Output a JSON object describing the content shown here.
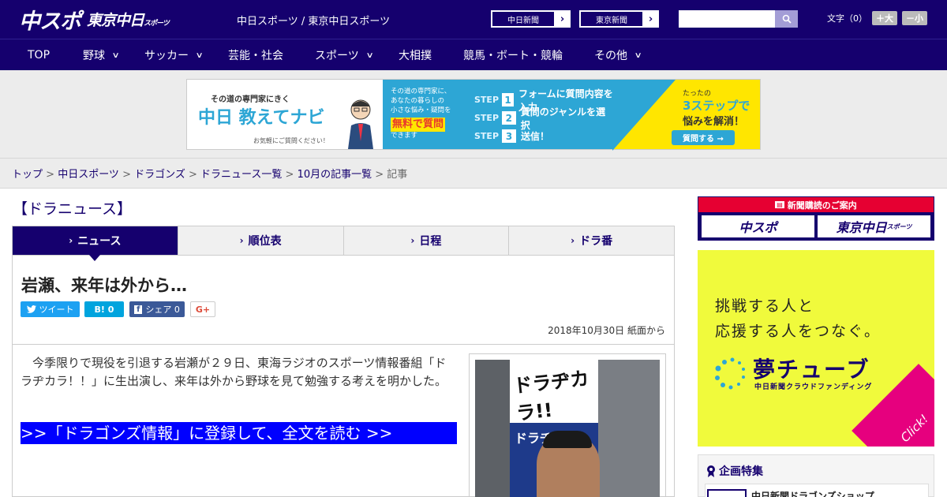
{
  "header": {
    "logo_main": "中スポ",
    "logo_sub": "東京中日",
    "logo_sub_small": "スポーツ",
    "site_title": "中日スポーツ / 東京中日スポーツ",
    "link1": "中日新聞",
    "link2": "東京新聞",
    "search_placeholder": "",
    "font_label": "文字（0）",
    "font_up": "＋大",
    "font_down": "－小"
  },
  "nav": {
    "items": [
      "TOP",
      "野球",
      "サッカー",
      "芸能・社会",
      "スポーツ",
      "大相撲",
      "競馬・ボート・競輪",
      "その他"
    ]
  },
  "banner": {
    "tag": "その道の専門家にきく",
    "brand": "中日 教えてナビ",
    "note": "お気軽にご質問ください！",
    "desc1": "その道の専門家に、",
    "desc2": "あなたの暮らしの",
    "desc3": "小さな悩み・疑問を",
    "desc_hl": "無料で質問",
    "desc4": "できます",
    "step_label": "STEP",
    "steps": [
      "フォームに質問内容を入力",
      "質問のジャンルを選択",
      "送信！"
    ],
    "cta1": "たったの",
    "cta2": "3ステップで",
    "cta3": "悩みを解消！",
    "cta_btn": "質問する →"
  },
  "breadcrumb": {
    "items": [
      "トップ",
      "中日スポーツ",
      "ドラゴンズ",
      "ドラニュース一覧",
      "10月の記事一覧"
    ],
    "current": "記事"
  },
  "section_title": "【ドラニュース】",
  "tabs": [
    "ニュース",
    "順位表",
    "日程",
    "ドラ番"
  ],
  "article": {
    "headline": "岩瀬、来年は外から…",
    "share_tweet": "ツイート",
    "share_hatena": "B! 0",
    "share_fb": "シェア 0",
    "share_gplus": "G+",
    "date": "2018年10月30日 紙面から",
    "body": "　今季限りで現役を引退する岩瀬が２９日、東海ラジオのスポーツ情報番組「ドラヂカラ！！」に生出演し、来年は外から野球を見て勉強する考えを明かした。",
    "read_more": ">>「ドラゴンズ情報」に登録して、全文を読む >>",
    "photo_board_text": "ドラヂカラ!!",
    "photo_board_text2": "ドラヂカ"
  },
  "sidebar": {
    "sub_head": "新聞購読のご案内",
    "sub_btn1": "中スポ",
    "sub_btn2": "東京中日",
    "sub_btn2_small": "スポーツ",
    "ad_line1": "挑戦する人と",
    "ad_line2": "応援する人をつなぐ。",
    "ad_brand": "夢チューブ",
    "ad_sub": "中日新聞クラウドファンディング",
    "ad_click": "Click!",
    "feature_head": "企画特集",
    "feature_item": "中日新聞ドラゴンズショップ"
  },
  "colors": {
    "brand_navy": "#15006e",
    "accent_red": "#e60032",
    "readmore_blue": "#0000ff",
    "banner_blue": "#2da6d5",
    "banner_yellow": "#ffe600"
  }
}
